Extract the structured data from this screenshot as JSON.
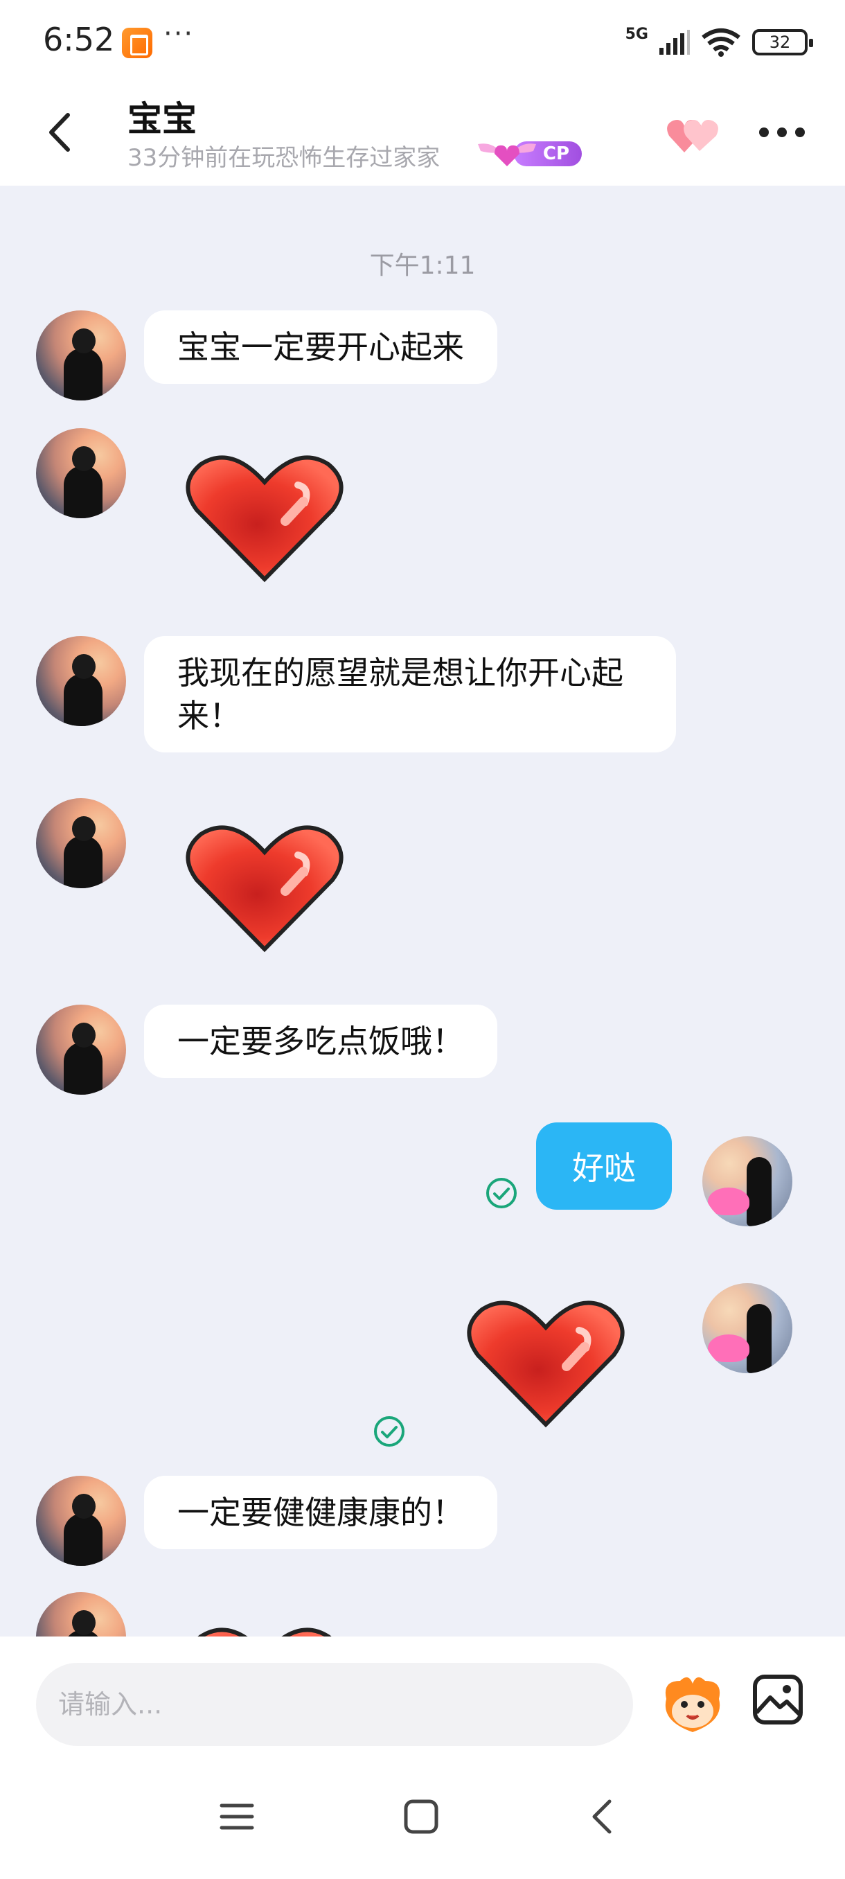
{
  "status_bar": {
    "time": "6:52",
    "dots": "···",
    "network": "5G",
    "battery": "32"
  },
  "header": {
    "title": "宝宝",
    "subtitle": "33分钟前在玩恐怖生存过家家",
    "badge": "CP"
  },
  "chat": {
    "timestamp": "下午1:11",
    "messages": [
      {
        "from": "other",
        "type": "text",
        "text": "宝宝一定要开心起来"
      },
      {
        "from": "other",
        "type": "sticker",
        "sticker": "heart-sticker"
      },
      {
        "from": "other",
        "type": "text",
        "text": "我现在的愿望就是想让你开心起来！"
      },
      {
        "from": "other",
        "type": "sticker",
        "sticker": "heart-sticker"
      },
      {
        "from": "other",
        "type": "text",
        "text": "一定要多吃点饭哦！"
      },
      {
        "from": "me",
        "type": "text",
        "text": "好哒",
        "read": true
      },
      {
        "from": "me",
        "type": "sticker",
        "sticker": "heart-sticker",
        "read": true
      },
      {
        "from": "other",
        "type": "text",
        "text": "一定要健健康康的！"
      },
      {
        "from": "other",
        "type": "sticker",
        "sticker": "heart-sticker"
      }
    ]
  },
  "input": {
    "placeholder": "请输入..."
  },
  "icons": {
    "back": "back-arrow-icon",
    "more": "more-icon",
    "intimacy": "double-heart-icon",
    "emoji": "emoji-icon",
    "image": "image-icon",
    "read": "check-circle-icon"
  },
  "colors": {
    "accent": "#2bb6f5",
    "read_check": "#1aa67a",
    "chat_bg": "#eef0f8",
    "cp_badge": "#a14fe0"
  }
}
